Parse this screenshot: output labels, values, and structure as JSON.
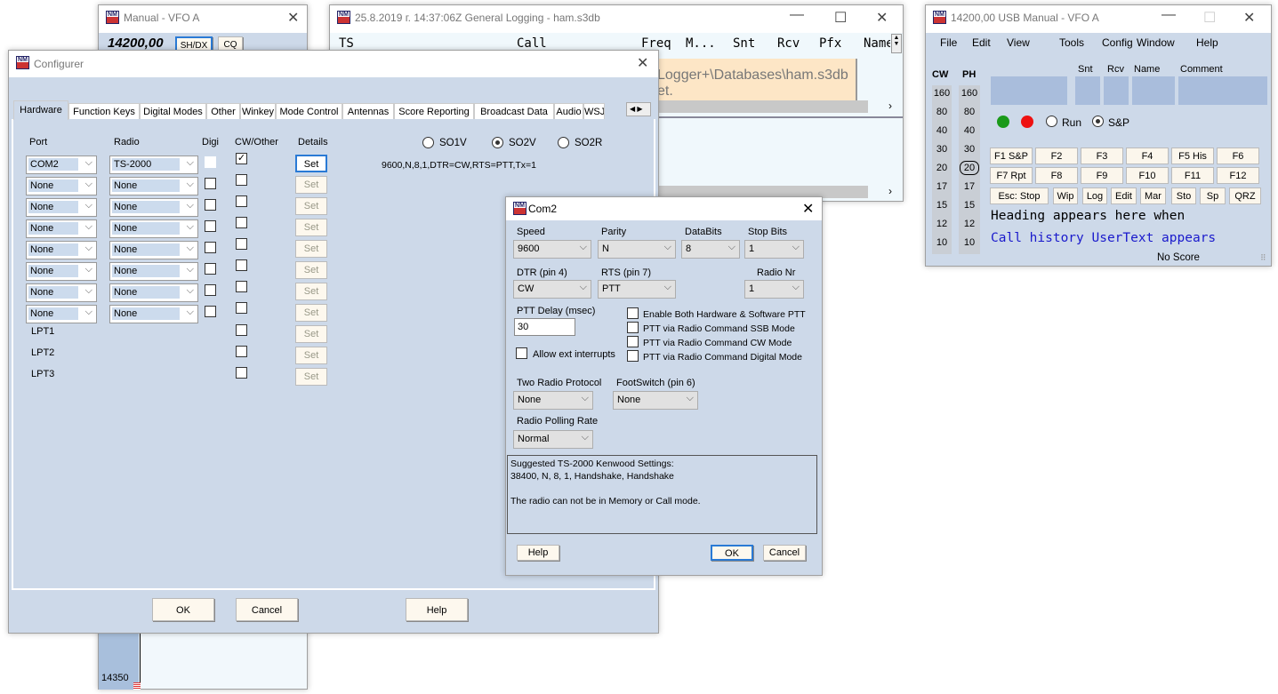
{
  "manual_vfo": {
    "title": "Manual - VFO A",
    "freq": "14200,00",
    "btn_shdx": "SH/DX",
    "btn_cq": "CQ",
    "scale_label": "14350"
  },
  "logging": {
    "title": "25.8.2019 г. 14:37:06Z  General Logging - ham.s3db",
    "columns": [
      "TS",
      "Call",
      "Freq",
      "M...",
      "Snt",
      "Rcv",
      "Pfx",
      "Name"
    ],
    "message_line1": "Logger+\\Databases\\ham.s3db",
    "message_line2": "et."
  },
  "configurer": {
    "title": "Configurer",
    "tabs": [
      "Hardware",
      "Function Keys",
      "Digital Modes",
      "Other",
      "Winkey",
      "Mode Control",
      "Antennas",
      "Score Reporting",
      "Broadcast Data",
      "Audio",
      "WSJ"
    ],
    "active_tab": "Hardware",
    "headers": {
      "port": "Port",
      "radio": "Radio",
      "digi": "Digi",
      "cw": "CW/Other",
      "details": "Details"
    },
    "so_options": [
      {
        "label": "SO1V",
        "selected": false
      },
      {
        "label": "SO2V",
        "selected": true
      },
      {
        "label": "SO2R",
        "selected": false
      }
    ],
    "details_text": "9600,N,8,1,DTR=CW,RTS=PTT,Tx=1",
    "rows": [
      {
        "port": "COM2",
        "radio": "TS-2000",
        "digi": null,
        "cw": true
      },
      {
        "port": "None",
        "radio": "None",
        "digi": false,
        "cw": false
      },
      {
        "port": "None",
        "radio": "None",
        "digi": false,
        "cw": false
      },
      {
        "port": "None",
        "radio": "None",
        "digi": false,
        "cw": false
      },
      {
        "port": "None",
        "radio": "None",
        "digi": false,
        "cw": false
      },
      {
        "port": "None",
        "radio": "None",
        "digi": false,
        "cw": false
      },
      {
        "port": "None",
        "radio": "None",
        "digi": false,
        "cw": false
      },
      {
        "port": "None",
        "radio": "None",
        "digi": false,
        "cw": false
      }
    ],
    "lpt": [
      "LPT1",
      "LPT2",
      "LPT3"
    ],
    "set_label": "Set",
    "ok": "OK",
    "cancel": "Cancel",
    "help": "Help"
  },
  "com2": {
    "title": "Com2",
    "speed_label": "Speed",
    "speed": "9600",
    "parity_label": "Parity",
    "parity": "N",
    "databits_label": "DataBits",
    "databits": "8",
    "stopbits_label": "Stop Bits",
    "stopbits": "1",
    "dtr_label": "DTR (pin 4)",
    "dtr": "CW",
    "rts_label": "RTS (pin 7)",
    "rts": "PTT",
    "radionr_label": "Radio Nr",
    "radionr": "1",
    "ptt_delay_label": "PTT Delay  (msec)",
    "ptt_delay": "30",
    "allow_ext": "Allow ext interrupts",
    "checks": [
      "Enable Both Hardware & Software PTT",
      "PTT via Radio Command SSB Mode",
      "PTT via Radio Command CW Mode",
      "PTT via Radio Command Digital Mode"
    ],
    "two_radio_label": "Two Radio Protocol",
    "two_radio": "None",
    "footswitch_label": "FootSwitch (pin 6)",
    "footswitch": "None",
    "polling_label": "Radio Polling Rate",
    "polling": "Normal",
    "info": [
      "Suggested TS-2000 Kenwood Settings:",
      "38400, N, 8, 1, Handshake, Handshake",
      "",
      "The radio can not be in Memory or Call mode."
    ],
    "help": "Help",
    "ok": "OK",
    "cancel": "Cancel"
  },
  "entry": {
    "title": "14200,00 USB Manual - VFO A",
    "menu": [
      "File",
      "Edit",
      "View",
      "Tools",
      "Config",
      "Window",
      "Help"
    ],
    "cw_label": "CW",
    "ph_label": "PH",
    "bands": [
      "160",
      "80",
      "40",
      "30",
      "20",
      "17",
      "15",
      "12",
      "10"
    ],
    "selected_band": "20",
    "field_labels": [
      "Snt",
      "Rcv",
      "Name",
      "Comment"
    ],
    "run": "Run",
    "sp": "S&P",
    "mode": "S&P",
    "fkeys1": [
      "F1 S&P",
      "F2",
      "F3",
      "F4",
      "F5 His",
      "F6"
    ],
    "fkeys2": [
      "F7 Rpt",
      "F8",
      "F9",
      "F10",
      "F11",
      "F12"
    ],
    "fkeys3": [
      "Esc: Stop",
      "Wip",
      "Log",
      "Edit",
      "Mar",
      "Sto",
      "Sp",
      "QRZ"
    ],
    "heading": "Heading appears here when",
    "call_history": "Call history UserText appears",
    "score": "No Score",
    "colors": {
      "green": "#1a9a1a",
      "red": "#ee1111",
      "blue_text": "#1a1acc"
    }
  }
}
